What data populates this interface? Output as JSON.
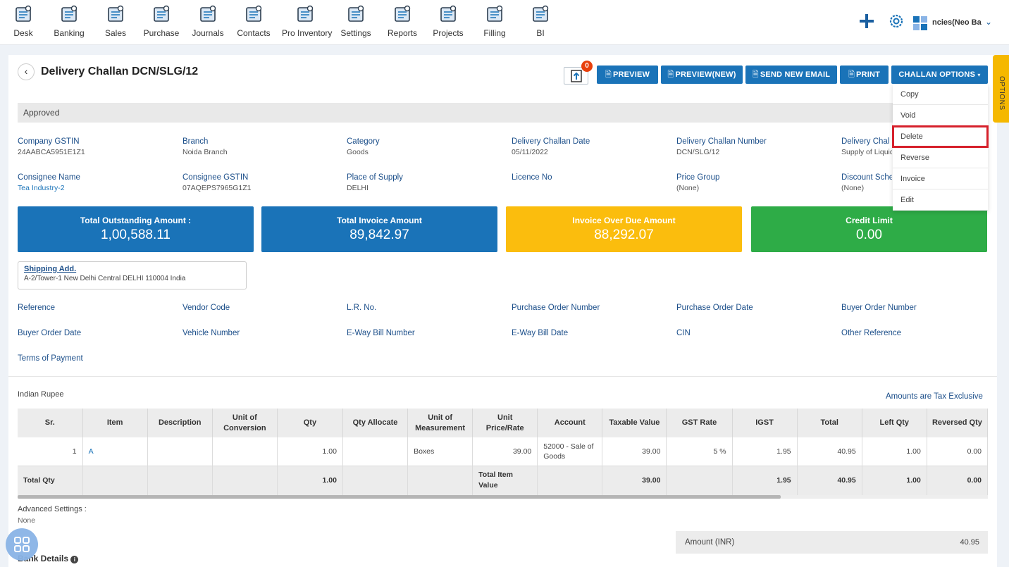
{
  "nav": [
    {
      "label": "Desk",
      "icon": "desk-icon"
    },
    {
      "label": "Banking",
      "icon": "bank-icon"
    },
    {
      "label": "Sales",
      "icon": "sales-icon"
    },
    {
      "label": "Purchase",
      "icon": "purchase-icon"
    },
    {
      "label": "Journals",
      "icon": "journals-icon"
    },
    {
      "label": "Contacts",
      "icon": "contacts-icon"
    },
    {
      "label": "Pro Inventory",
      "icon": "inventory-icon"
    },
    {
      "label": "Settings",
      "icon": "settings-tools-icon"
    },
    {
      "label": "Reports",
      "icon": "reports-icon"
    },
    {
      "label": "Projects",
      "icon": "projects-icon"
    },
    {
      "label": "Filling",
      "icon": "filling-icon"
    },
    {
      "label": "BI",
      "icon": "bi-icon"
    }
  ],
  "company": {
    "name": "ncies(Neo Ba"
  },
  "page": {
    "title": "Delivery Challan DCN/SLG/12",
    "status": "Approved",
    "badge_count": "0"
  },
  "actions": {
    "preview": "PREVIEW",
    "preview_new": "PREVIEW(NEW)",
    "send_email": "SEND NEW EMAIL",
    "print": "PRINT",
    "challan_options": "CHALLAN OPTIONS",
    "pdf_glyph": "🗎"
  },
  "dropdown": [
    "Copy",
    "Void",
    "Delete",
    "Reverse",
    "Invoice",
    "Edit"
  ],
  "options_tab": "OPTIONS",
  "fields_row1": [
    {
      "label": "Company GSTIN",
      "value": "24AABCA5951E1Z1"
    },
    {
      "label": "Branch",
      "value": "Noida Branch"
    },
    {
      "label": "Category",
      "value": "Goods"
    },
    {
      "label": "Delivery Challan Date",
      "value": "05/11/2022"
    },
    {
      "label": "Delivery Challan Number",
      "value": "DCN/SLG/12"
    },
    {
      "label": "Delivery Chal",
      "value": "Supply of Liquid"
    }
  ],
  "fields_row2": [
    {
      "label": "Consignee Name",
      "value": "Tea Industry-2"
    },
    {
      "label": "Consignee GSTIN",
      "value": "07AQEPS7965G1Z1"
    },
    {
      "label": "Place of Supply",
      "value": "DELHI"
    },
    {
      "label": "Licence No",
      "value": ""
    },
    {
      "label": "Price Group",
      "value": "(None)"
    },
    {
      "label": "Discount Sche",
      "value": "(None)"
    }
  ],
  "cards": [
    {
      "label": "Total Outstanding Amount :",
      "value": "1,00,588.11",
      "color": "#1a73b8"
    },
    {
      "label": "Total Invoice Amount",
      "value": "89,842.97",
      "color": "#1a73b8"
    },
    {
      "label": "Invoice Over Due Amount",
      "value": "88,292.07",
      "color": "#fbbd0d"
    },
    {
      "label": "Credit Limit",
      "value": "0.00",
      "color": "#2eac47"
    }
  ],
  "shipping": {
    "title": "Shipping Add.",
    "address": "A-2/Tower-1 New Delhi Central DELHI 110004 India"
  },
  "ref_row1": [
    "Reference",
    "Vendor Code",
    "L.R. No.",
    "Purchase Order Number",
    "Purchase Order Date",
    "Buyer Order Number"
  ],
  "ref_row2": [
    "Buyer Order Date",
    "Vehicle Number",
    "E-Way Bill Number",
    "E-Way Bill Date",
    "CIN",
    "Other Reference"
  ],
  "ref_row3": [
    "Terms of Payment"
  ],
  "currency": "Indian Rupee",
  "tax_note": "Amounts are Tax Exclusive",
  "table": {
    "headers": [
      "Sr.",
      "Item",
      "Description",
      "Unit of\nConversion",
      "Qty",
      "Qty Allocate",
      "Unit of\nMeasurement",
      "Unit\nPrice/Rate",
      "Account",
      "Taxable Value",
      "GST Rate",
      "IGST",
      "Total",
      "Left Qty",
      "Reversed Qty"
    ],
    "row": {
      "sr": "1",
      "item": "A",
      "description": "",
      "conversion": "",
      "qty": "1.00",
      "qty_allocate": "",
      "uom": "Boxes",
      "rate": "39.00",
      "account": "52000 - Sale of Goods",
      "taxable": "39.00",
      "gst_rate": "5 %",
      "igst": "1.95",
      "total": "40.95",
      "left_qty": "1.00",
      "reversed_qty": "0.00"
    },
    "totals": {
      "label": "Total Qty",
      "qty": "1.00",
      "item_value_label": "Total Item Value",
      "taxable": "39.00",
      "igst": "1.95",
      "total": "40.95",
      "left_qty": "1.00",
      "reversed_qty": "0.00"
    }
  },
  "advanced": {
    "label": "Advanced Settings :",
    "value": "None"
  },
  "amount": {
    "label": "Amount (INR)",
    "value": "40.95"
  },
  "bank": {
    "label": "Bank Details"
  }
}
